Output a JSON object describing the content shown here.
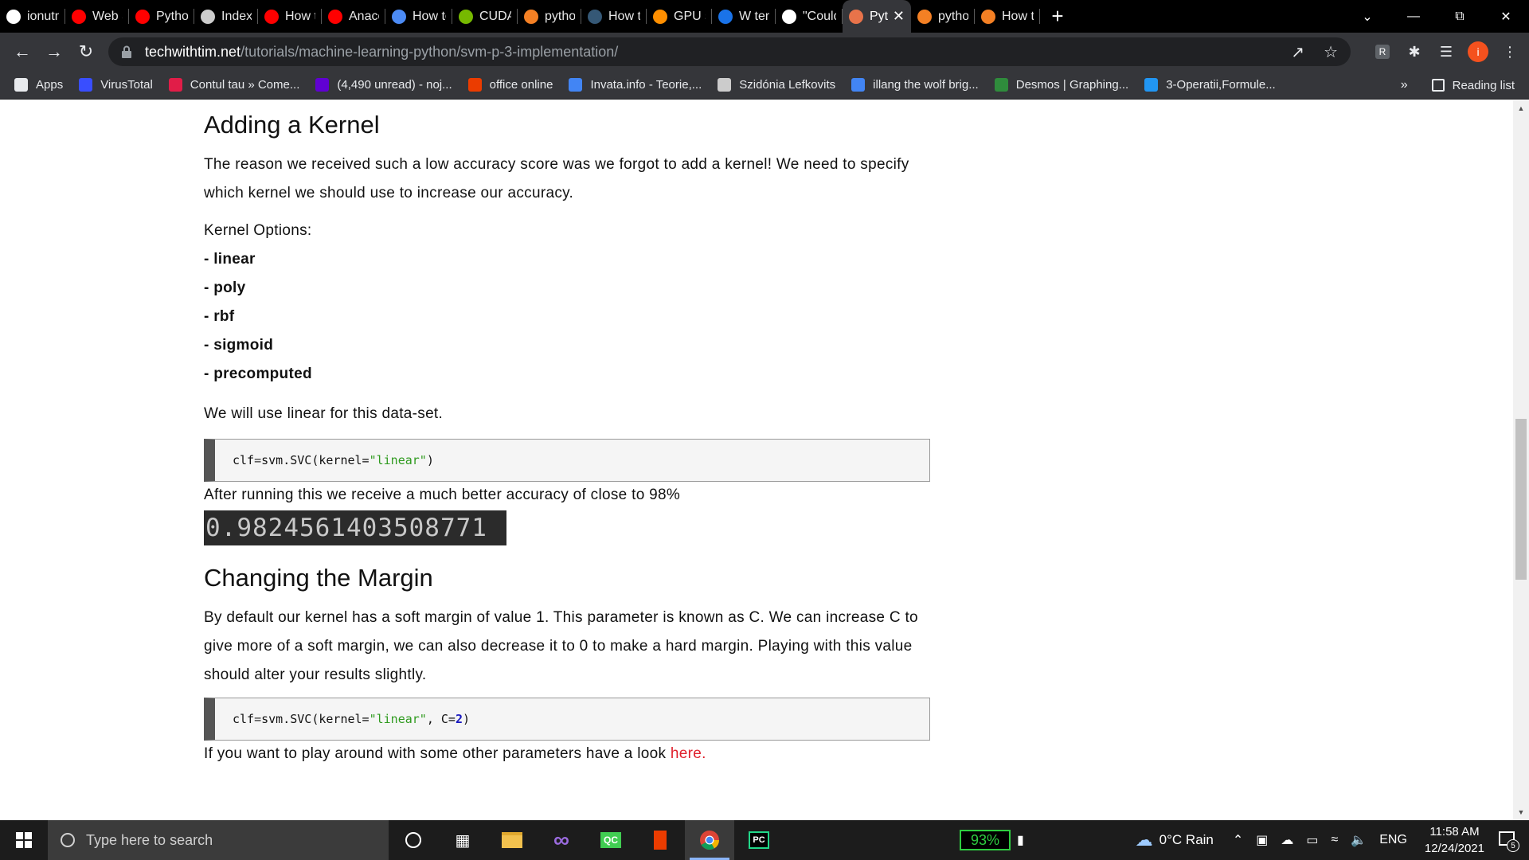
{
  "tabs": [
    {
      "label": "ionutnc",
      "icon": "github-icon",
      "color": "#ffffff"
    },
    {
      "label": "Web Sc",
      "icon": "youtube-icon",
      "color": "#ff0000"
    },
    {
      "label": "Python",
      "icon": "youtube-icon",
      "color": "#ff0000"
    },
    {
      "label": "Index o",
      "icon": "globe-icon",
      "color": "#cccccc"
    },
    {
      "label": "How to",
      "icon": "youtube-icon",
      "color": "#ff0000"
    },
    {
      "label": "Anacon",
      "icon": "youtube-icon",
      "color": "#ff0000"
    },
    {
      "label": "How to",
      "icon": "geeks-icon",
      "color": "#4c8bf5"
    },
    {
      "label": "CUDA T",
      "icon": "nvidia-icon",
      "color": "#76b900"
    },
    {
      "label": "python",
      "icon": "stackoverflow-icon",
      "color": "#f48024"
    },
    {
      "label": "How to",
      "icon": "tds-icon",
      "color": "#355876"
    },
    {
      "label": "GPU su",
      "icon": "tensorflow-icon",
      "color": "#ff8f00"
    },
    {
      "label": "W tens",
      "icon": "ring-icon",
      "color": "#1a73e8"
    },
    {
      "label": "\"Could",
      "icon": "github-icon",
      "color": "#ffffff"
    },
    {
      "label": "Pyt",
      "icon": "twt-icon",
      "color": "#e8734a",
      "active": true
    },
    {
      "label": "python",
      "icon": "stackoverflow-icon",
      "color": "#f48024"
    },
    {
      "label": "How to",
      "icon": "stackoverflow-icon",
      "color": "#f48024"
    }
  ],
  "toolbar": {
    "url_host": "techwithtim.net",
    "url_path": "/tutorials/machine-learning-python/svm-p-3-implementation/",
    "avatar_letter": "i"
  },
  "bookmarks": [
    {
      "label": "Apps",
      "icon": "apps-grid-icon",
      "color": "#e8eaed"
    },
    {
      "label": "VirusTotal",
      "icon": "virustotal-icon",
      "color": "#394eff"
    },
    {
      "label": "Contul tau » Come...",
      "icon": "emag-icon",
      "color": "#e11d48"
    },
    {
      "label": "(4,490 unread) - noj...",
      "icon": "yahoo-mail-icon",
      "color": "#6001d2"
    },
    {
      "label": "office online",
      "icon": "office-icon",
      "color": "#eb3c00"
    },
    {
      "label": "Invata.info - Teorie,...",
      "icon": "google-icon",
      "color": "#4285f4"
    },
    {
      "label": "Szidónia Lefkovits",
      "icon": "globe-icon",
      "color": "#cccccc"
    },
    {
      "label": "illang the wolf brig...",
      "icon": "google-icon",
      "color": "#4285f4"
    },
    {
      "label": "Desmos | Graphing...",
      "icon": "desmos-icon",
      "color": "#2f8c3c"
    },
    {
      "label": "3-Operatii,Formule...",
      "icon": "s-icon",
      "color": "#2196f3"
    }
  ],
  "bookmarks_more": "»",
  "reading_list": "Reading list",
  "article": {
    "h_kernel": "Adding a Kernel",
    "p_kernel": "The reason we received such a low accuracy score was we forgot to add a kernel! We need to specify which kernel we should use to increase our accuracy.",
    "kernel_options_label": "Kernel Options:",
    "kernel_options": [
      "- linear",
      "- poly",
      "- rbf",
      "- sigmoid",
      "- precomputed"
    ],
    "p_use_linear": "We will use linear for this data-set.",
    "code1": {
      "prefix": "clf ",
      "eq": "=",
      "mid": " svm.SVC(kernel=",
      "str": "\"linear\"",
      "suffix": ")"
    },
    "p_after": "After running this we receive a much better accuracy of close to 98%",
    "accuracy_output": "0.9824561403508771",
    "h_margin": "Changing the Margin",
    "p_margin": "By default our kernel has a soft margin of value 1. This parameter is known as C. We can increase C to give more of a soft margin, we can also decrease it to 0 to make a hard margin. Playing with this value should alter your results slightly.",
    "code2": {
      "prefix": "clf ",
      "eq": "=",
      "mid": " svm.SVC(kernel=",
      "str": "\"linear\"",
      "mid2": ", C=",
      "num": "2",
      "suffix": ")"
    },
    "p_other": "If you want to play around with some other parameters have a look ",
    "link_here": "here."
  },
  "taskbar": {
    "search_placeholder": "Type here to search",
    "battery": "93%",
    "weather": "0°C  Rain",
    "lang": "ENG",
    "time": "11:58 AM",
    "date": "12/24/2021",
    "notif_count": "5"
  }
}
